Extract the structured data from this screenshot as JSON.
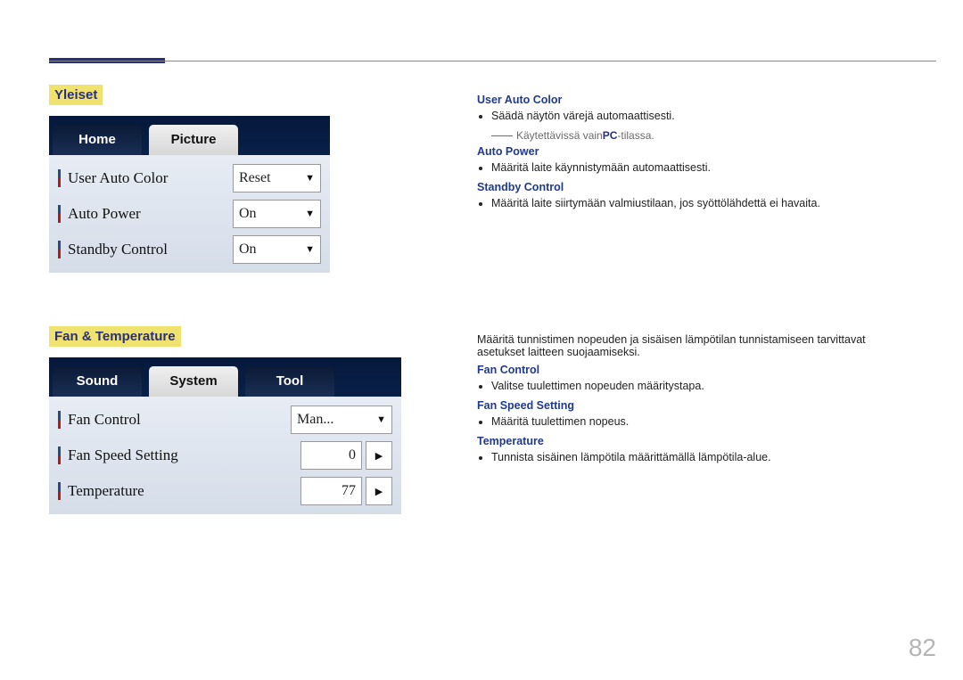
{
  "section1": {
    "title": "Yleiset",
    "tabs": {
      "home": "Home",
      "picture": "Picture"
    },
    "rows": {
      "userAutoColor": {
        "label": "User Auto Color",
        "value": "Reset"
      },
      "autoPower": {
        "label": "Auto Power",
        "value": "On"
      },
      "standbyCtrl": {
        "label": "Standby Control",
        "value": "On"
      }
    },
    "explain": {
      "userAutoColor": {
        "heading": "User Auto Color",
        "bullet": "Säädä näytön värejä automaattisesti.",
        "note_prefix": "Käytettävissä vain ",
        "note_bold": "PC",
        "note_suffix": "-tilassa."
      },
      "autoPower": {
        "heading": "Auto Power",
        "bullet": "Määritä laite käynnistymään automaattisesti."
      },
      "standbyCtrl": {
        "heading": "Standby Control",
        "bullet": "Määritä laite siirtymään valmiustilaan, jos syöttölähdettä ei havaita."
      }
    }
  },
  "section2": {
    "title": "Fan & Temperature",
    "tabs": {
      "sound": "Sound",
      "system": "System",
      "tool": "Tool"
    },
    "rows": {
      "fanControl": {
        "label": "Fan Control",
        "value": "Man..."
      },
      "fanSpeed": {
        "label": "Fan Speed Setting",
        "value": "0"
      },
      "temperature": {
        "label": "Temperature",
        "value": "77"
      }
    },
    "explain": {
      "intro": "Määritä tunnistimen nopeuden ja sisäisen lämpötilan tunnistamiseen tarvittavat asetukset laitteen suojaamiseksi.",
      "fanControl": {
        "heading": "Fan Control",
        "bullet": "Valitse tuulettimen nopeuden määritystapa."
      },
      "fanSpeed": {
        "heading": "Fan Speed Setting",
        "bullet": "Määritä tuulettimen nopeus."
      },
      "temperature": {
        "heading": "Temperature",
        "bullet": "Tunnista sisäinen lämpötila määrittämällä lämpötila-alue."
      }
    }
  },
  "pageNumber": "82"
}
